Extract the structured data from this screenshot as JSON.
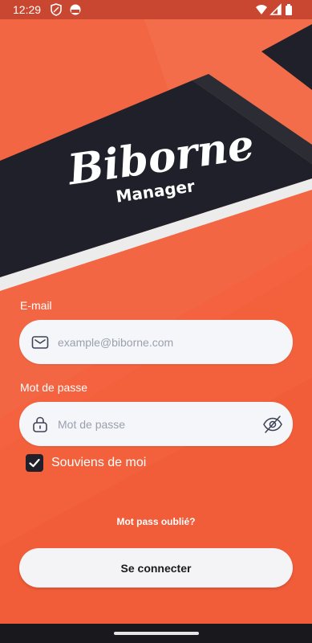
{
  "status_bar": {
    "time": "12:29",
    "icons": [
      "shield-icon",
      "app-icon",
      "wifi-icon",
      "signal-icon",
      "battery-icon"
    ]
  },
  "brand": {
    "logo_text": "Biborne",
    "logo_subtext": "Manager"
  },
  "form": {
    "email_label": "E-mail",
    "email_placeholder": "example@biborne.com",
    "password_label": "Mot de passe",
    "password_placeholder": "Mot de passe",
    "remember_label": "Souviens de moi",
    "remember_checked": true,
    "forgot_link": "Mot pass oublié?",
    "submit_label": "Se connecter"
  },
  "colors": {
    "background": "#f4623f",
    "dark_band": "#1f2029",
    "field_bg": "#f4f6fa",
    "button_bg": "#f4f4f6"
  }
}
